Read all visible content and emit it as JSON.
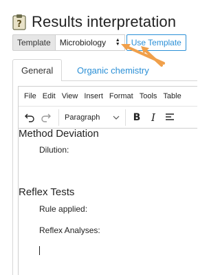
{
  "page": {
    "title": "Results interpretation",
    "title_icon": "clipboard-question-icon"
  },
  "template_bar": {
    "label": "Template",
    "selected": "Microbiology",
    "button_label": "Use Template"
  },
  "tabs": [
    {
      "label": "General",
      "active": true
    },
    {
      "label": "Organic chemistry",
      "active": false
    }
  ],
  "editor": {
    "menu": [
      "File",
      "Edit",
      "View",
      "Insert",
      "Format",
      "Tools",
      "Table"
    ],
    "toolbar": {
      "undo_icon": "undo-icon",
      "redo_icon": "redo-icon",
      "block_format": "Paragraph",
      "bold": "B",
      "italic": "I",
      "align_icon": "align-left-icon"
    },
    "content": {
      "heading_1": "Method Deviation",
      "dilution": "Dilution:",
      "heading_2": "Reflex Tests",
      "rule_applied": "Rule applied:",
      "reflex_analyses": "Reflex Analyses:"
    }
  },
  "colors": {
    "accent": "#2a8fd6",
    "annotation": "#f0a04b"
  }
}
